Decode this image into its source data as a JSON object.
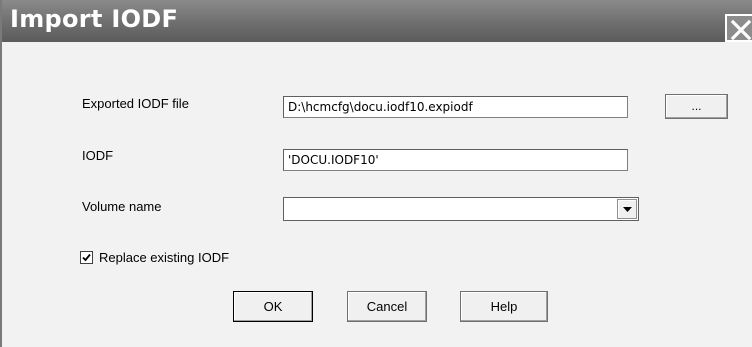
{
  "dialog": {
    "title": "Import IODF",
    "close_icon": "close-icon"
  },
  "form": {
    "exported_file_label": "Exported IODF file",
    "exported_file_value": "D:\\hcmcfg\\docu.iodf10.expiodf",
    "browse_label": "...",
    "iodf_label": "IODF",
    "iodf_value": "'DOCU.IODF10'",
    "volume_label": "Volume name",
    "volume_value": "",
    "replace_label": "Replace existing IODF",
    "replace_checked": true
  },
  "buttons": {
    "ok": "OK",
    "cancel": "Cancel",
    "help": "Help"
  }
}
